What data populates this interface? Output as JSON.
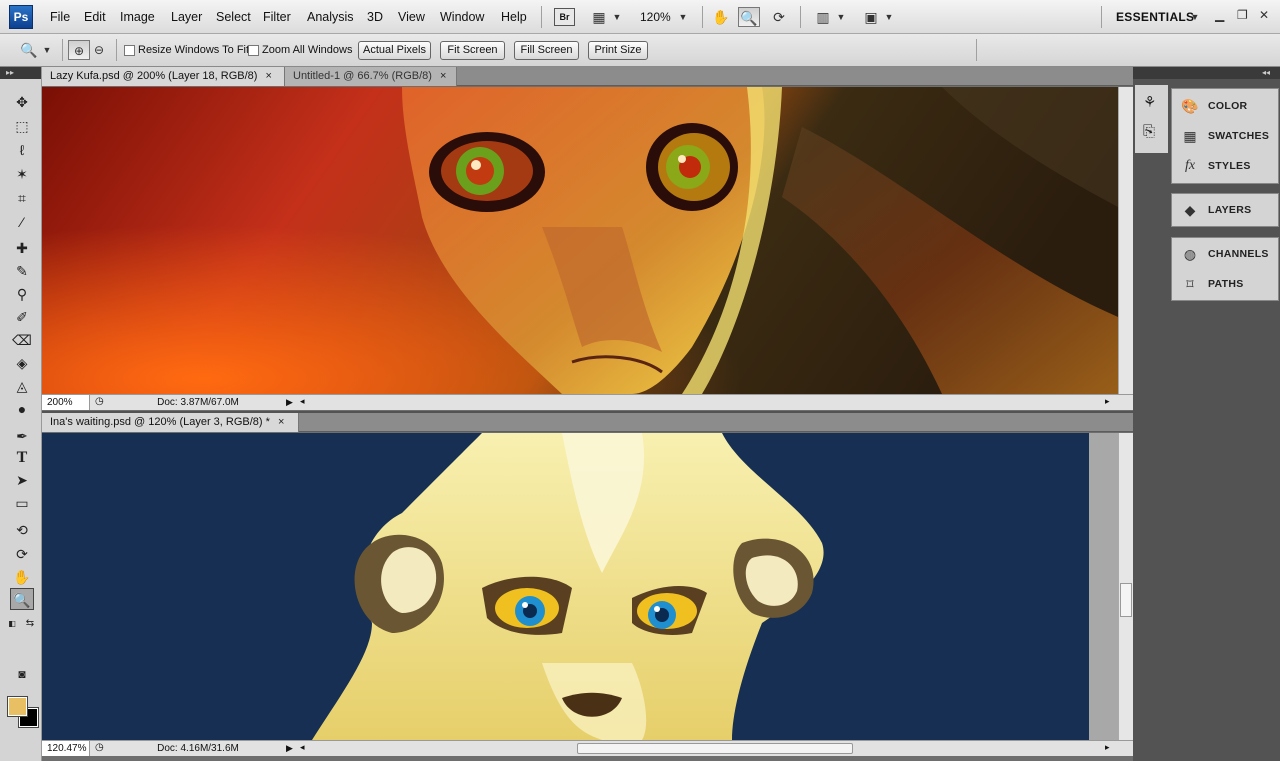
{
  "app": {
    "logo": "Ps"
  },
  "menu": [
    "File",
    "Edit",
    "Image",
    "Layer",
    "Select",
    "Filter",
    "Analysis",
    "3D",
    "View",
    "Window",
    "Help"
  ],
  "toolbar": {
    "bridge_label": "Br",
    "zoom_level": "120%",
    "workspace": "ESSENTIALS"
  },
  "options": {
    "resize_windows": "Resize Windows To Fit",
    "zoom_all": "Zoom All Windows",
    "actual_pixels": "Actual Pixels",
    "fit_screen": "Fit Screen",
    "fill_screen": "Fill Screen",
    "print_size": "Print Size"
  },
  "doc1": {
    "tabs": [
      {
        "label": "Lazy Kufa.psd @ 200% (Layer 18, RGB/8)",
        "close": "×"
      },
      {
        "label": "Untitled-1 @ 66.7% (RGB/8)",
        "close": "×"
      }
    ],
    "zoom": "200%",
    "doc_size": "Doc: 3.87M/67.0M"
  },
  "doc2": {
    "tabs": [
      {
        "label": "Ina's waiting.psd @ 120% (Layer 3, RGB/8) *",
        "close": "×"
      }
    ],
    "zoom": "120.47%",
    "doc_size": "Doc: 4.16M/31.6M"
  },
  "panels": {
    "group1": [
      "COLOR",
      "SWATCHES",
      "STYLES"
    ],
    "group2": [
      "LAYERS"
    ],
    "group3": [
      "CHANNELS",
      "PATHS"
    ]
  },
  "colors": {
    "foreground": "#e8c063",
    "background": "#000000",
    "accent": "#1b63b8"
  }
}
